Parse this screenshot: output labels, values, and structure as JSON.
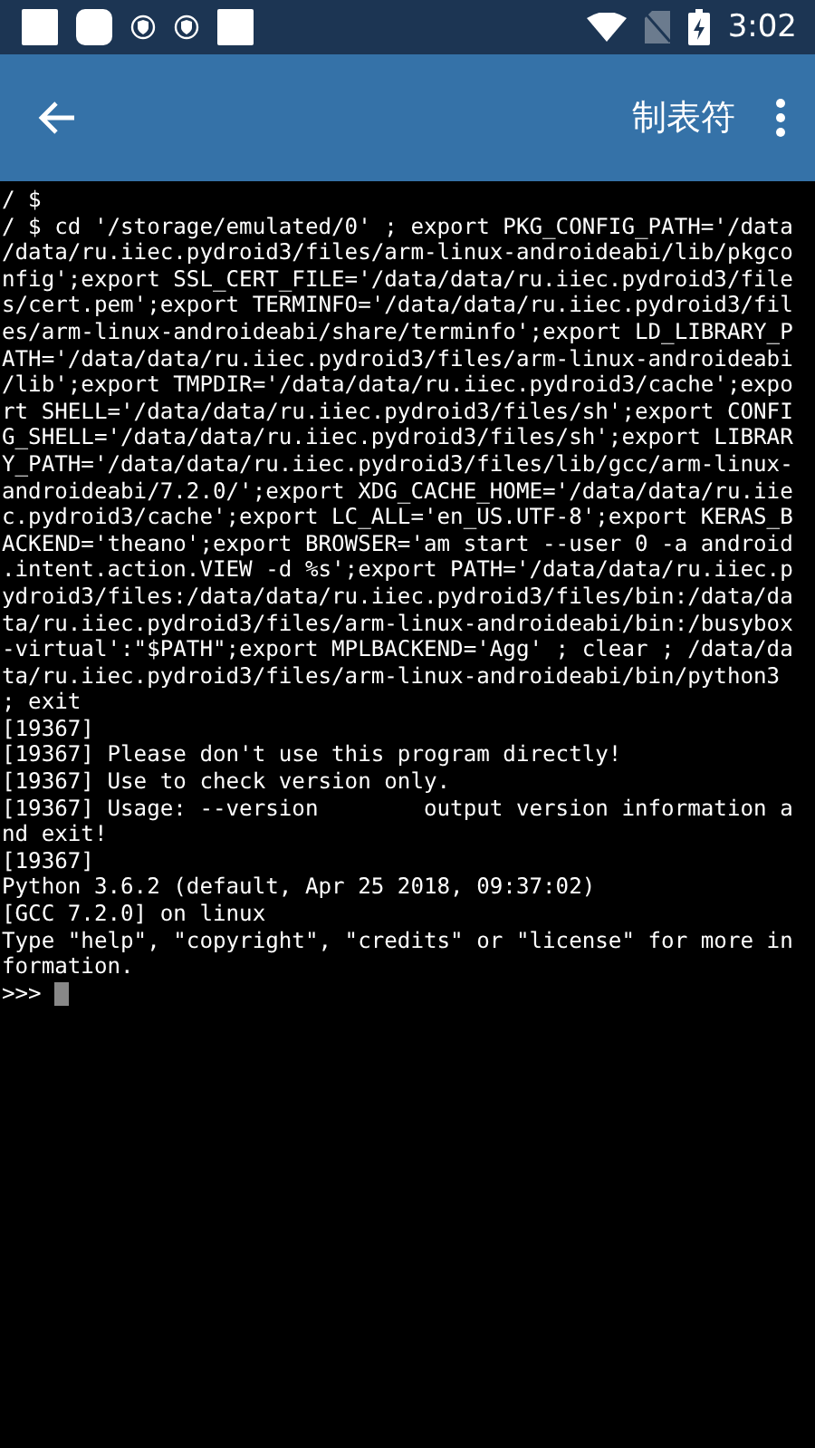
{
  "status_bar": {
    "time": "3:02"
  },
  "toolbar": {
    "title": "制表符"
  },
  "terminal": {
    "lines": [
      "/ $",
      "/ $ cd '/storage/emulated/0' ; export PKG_CONFIG_PATH='/data",
      "/data/ru.iiec.pydroid3/files/arm-linux-androideabi/lib/pkgco",
      "nfig';export SSL_CERT_FILE='/data/data/ru.iiec.pydroid3/file",
      "s/cert.pem';export TERMINFO='/data/data/ru.iiec.pydroid3/fil",
      "es/arm-linux-androideabi/share/terminfo';export LD_LIBRARY_P",
      "ATH='/data/data/ru.iiec.pydroid3/files/arm-linux-androideabi",
      "/lib';export TMPDIR='/data/data/ru.iiec.pydroid3/cache';expo",
      "rt SHELL='/data/data/ru.iiec.pydroid3/files/sh';export CONFI",
      "G_SHELL='/data/data/ru.iiec.pydroid3/files/sh';export LIBRAR",
      "Y_PATH='/data/data/ru.iiec.pydroid3/files/lib/gcc/arm-linux-",
      "androideabi/7.2.0/';export XDG_CACHE_HOME='/data/data/ru.iie",
      "c.pydroid3/cache';export LC_ALL='en_US.UTF-8';export KERAS_B",
      "ACKEND='theano';export BROWSER='am start --user 0 -a android",
      ".intent.action.VIEW -d %s';export PATH='/data/data/ru.iiec.p",
      "ydroid3/files:/data/data/ru.iiec.pydroid3/files/bin:/data/da",
      "ta/ru.iiec.pydroid3/files/arm-linux-androideabi/bin:/busybox",
      "-virtual':\"$PATH\";export MPLBACKEND='Agg' ; clear ; /data/da",
      "ta/ru.iiec.pydroid3/files/arm-linux-androideabi/bin/python3",
      "; exit",
      "[19367]",
      "[19367] Please don't use this program directly!",
      "[19367] Use to check version only.",
      "[19367] Usage: --version        output version information a",
      "nd exit!",
      "[19367]",
      "Python 3.6.2 (default, Apr 25 2018, 09:37:02)",
      "[GCC 7.2.0] on linux",
      "Type \"help\", \"copyright\", \"credits\" or \"license\" for more in",
      "formation."
    ],
    "prompt": ">>> "
  }
}
